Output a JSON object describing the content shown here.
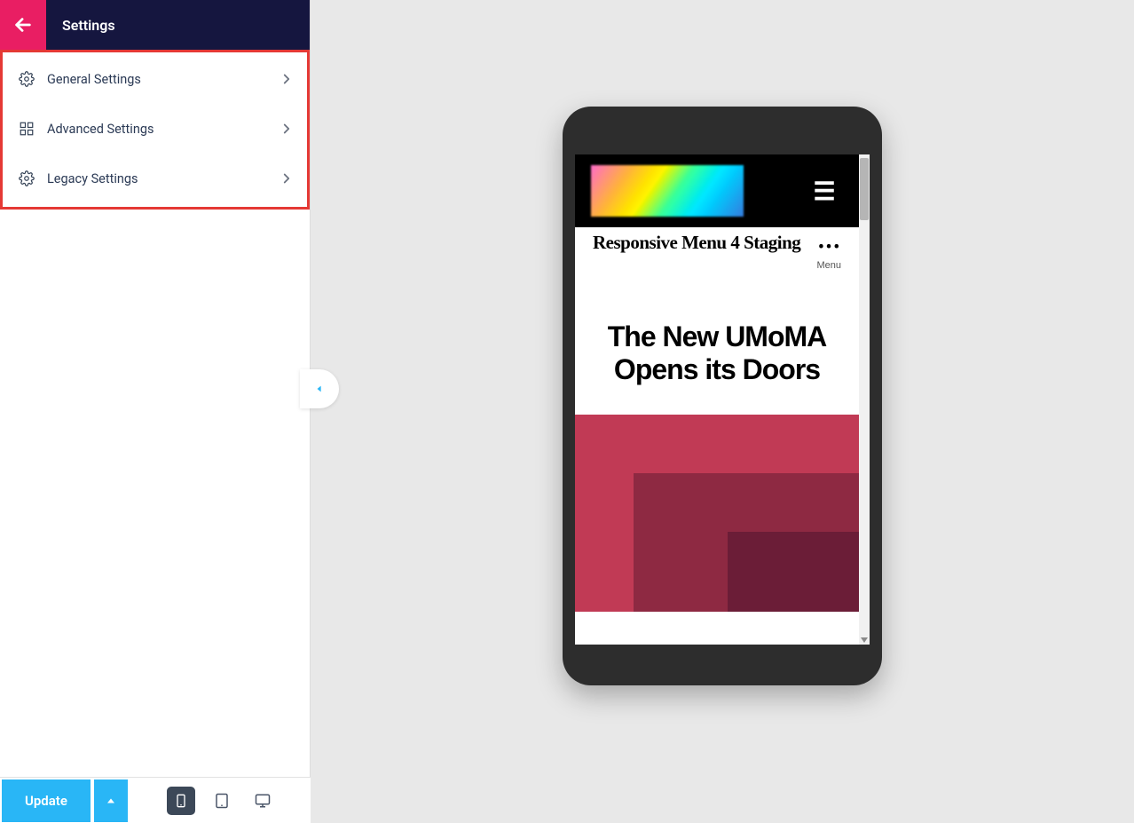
{
  "sidebar": {
    "title": "Settings",
    "items": [
      {
        "label": "General Settings"
      },
      {
        "label": "Advanced Settings"
      },
      {
        "label": "Legacy Settings"
      }
    ]
  },
  "footer": {
    "update_label": "Update"
  },
  "preview": {
    "site_title": "Responsive Menu 4 Staging",
    "menu_label": "Menu",
    "hero": "The New UMoMA Opens its Doors",
    "hamburger_glyph": "☰"
  }
}
